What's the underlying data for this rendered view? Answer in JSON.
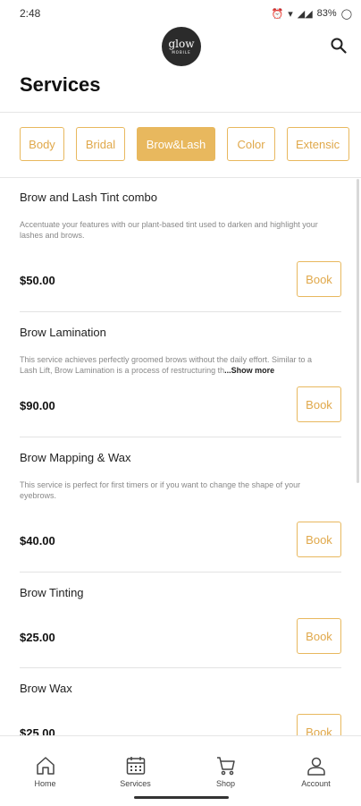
{
  "status": {
    "time": "2:48",
    "battery": "83%"
  },
  "app": {
    "logo_text": "glow",
    "logo_sub": "MOBILE",
    "title": "Services"
  },
  "tabs": [
    {
      "label": "Body",
      "active": false
    },
    {
      "label": "Bridal",
      "active": false
    },
    {
      "label": "Brow&Lash",
      "active": true
    },
    {
      "label": "Color",
      "active": false
    },
    {
      "label": "Extensic",
      "active": false
    }
  ],
  "services": [
    {
      "name": "Brow and Lash Tint combo",
      "desc": "Accentuate your features with our plant-based tint used to darken and highlight your lashes and brows.",
      "show_more": "",
      "price": "$50.00",
      "book": "Book"
    },
    {
      "name": "Brow Lamination",
      "desc": "This service achieves perfectly groomed brows without the daily effort. Similar to a Lash Lift, Brow Lamination is a process of restructuring th",
      "show_more": "...Show more",
      "price": "$90.00",
      "book": "Book"
    },
    {
      "name": "Brow Mapping & Wax",
      "desc": "This service is perfect for first timers or if you want to change the shape of your eyebrows.",
      "show_more": "",
      "price": "$40.00",
      "book": "Book"
    },
    {
      "name": "Brow Tinting",
      "desc": "",
      "show_more": "",
      "price": "$25.00",
      "book": "Book"
    },
    {
      "name": "Brow Wax",
      "desc": "",
      "show_more": "",
      "price": "$25.00",
      "book": "Book"
    }
  ],
  "nav": {
    "home": "Home",
    "services": "Services",
    "shop": "Shop",
    "account": "Account"
  },
  "colors": {
    "accent": "#e8b85e"
  }
}
